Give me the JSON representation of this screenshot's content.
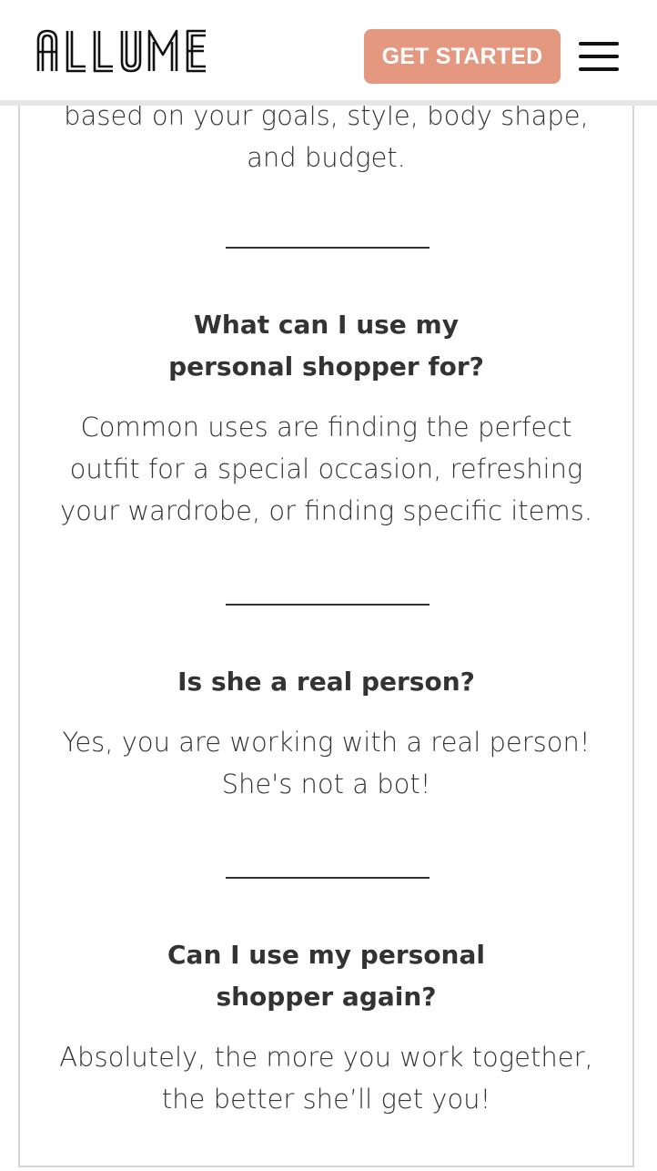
{
  "header": {
    "logo_text": "ALLUME",
    "cta_label": "GET STARTED",
    "menu_icon": "hamburger-menu-icon"
  },
  "intro": {
    "partial_line": "based on your goals, style, body shape,",
    "last_line": "and budget."
  },
  "faq": [
    {
      "question_lines": [
        "What can I use my",
        "personal shopper for?"
      ],
      "answer_lines": [
        "Common uses are finding the perfect",
        "outfit for a special occasion, refreshing",
        "your wardrobe, or finding specific items."
      ]
    },
    {
      "question_lines": [
        "Is she a real person?"
      ],
      "answer_lines": [
        "Yes, you are working with a real person!",
        "She's not a bot!"
      ]
    },
    {
      "question_lines": [
        "Can I use my personal",
        "shopper again?"
      ],
      "answer_lines": [
        "Absolutely, the more you work together,",
        "the better she’ll get you!"
      ]
    }
  ],
  "colors": {
    "accent": "#e4987f",
    "text": "#333333",
    "border": "#d6d6d6"
  }
}
